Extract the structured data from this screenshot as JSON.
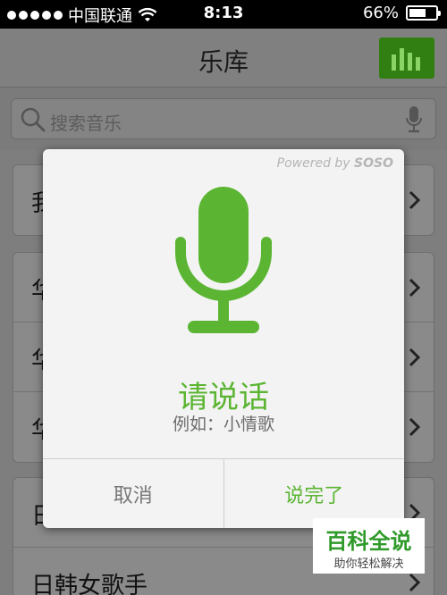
{
  "status_bar": {
    "carrier": "中国联通",
    "time": "8:13",
    "battery": "66%",
    "battery_level": 0.66
  },
  "nav": {
    "title": "乐库",
    "chart_icon": "bar-chart-icon"
  },
  "search": {
    "placeholder": "搜索音乐",
    "search_icon": "search-icon",
    "mic_icon": "microphone-icon"
  },
  "list": {
    "group1": [
      {
        "label": "我"
      }
    ],
    "group2": [
      {
        "label": "华"
      },
      {
        "label": "华"
      },
      {
        "label": "华"
      }
    ],
    "group3": [
      {
        "label": "日"
      },
      {
        "label": "日韩女歌手"
      }
    ]
  },
  "dialog": {
    "powered_prefix": "Powered by ",
    "powered_brand": "SOSO",
    "prompt": "请说话",
    "example": "例如：小情歌",
    "cancel_label": "取消",
    "done_label": "说完了",
    "accent_color": "#5bb532"
  },
  "watermark": {
    "title": "百科全说",
    "subtitle": "助你轻松解决"
  }
}
